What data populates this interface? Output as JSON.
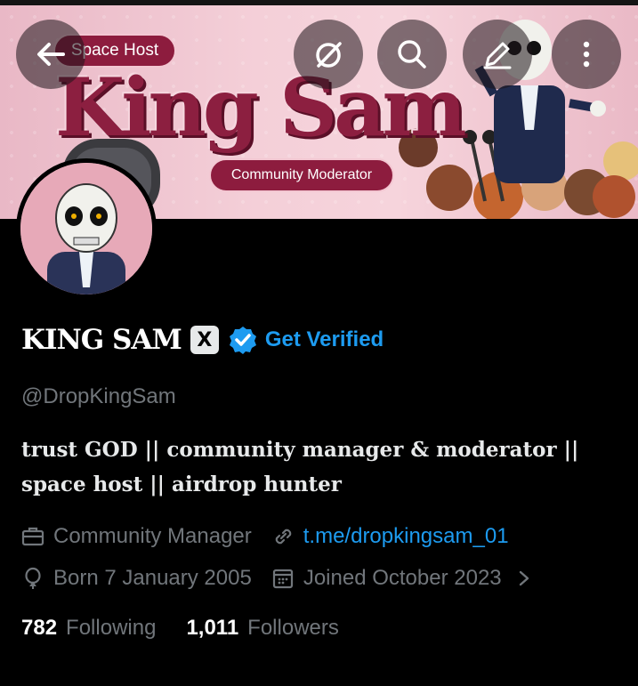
{
  "banner": {
    "pill_host": "Space Host",
    "title_art": "King Sam",
    "pill_moderator": "Community Moderator"
  },
  "icons": {
    "back": "back-arrow-icon",
    "logo": "circle-slash-icon",
    "search": "search-icon",
    "edit": "edit-icon",
    "more": "more-vertical-icon",
    "x_badge": "X",
    "verified": "verified-check-icon"
  },
  "profile": {
    "name": "KING SAM",
    "get_verified": "Get Verified",
    "handle": "@DropKingSam",
    "bio": "trust GOD || community manager & moderator || space host || airdrop hunter",
    "profession": "Community Manager",
    "link": "t.me/dropkingsam_01",
    "born": "Born 7 January 2005",
    "joined": "Joined October 2023"
  },
  "stats": {
    "following_count": "782",
    "following_label": "Following",
    "followers_count": "1,011",
    "followers_label": "Followers"
  },
  "colors": {
    "accent": "#1d9bf0",
    "banner_pill": "#8d1c3e",
    "muted_text": "#71767b"
  }
}
